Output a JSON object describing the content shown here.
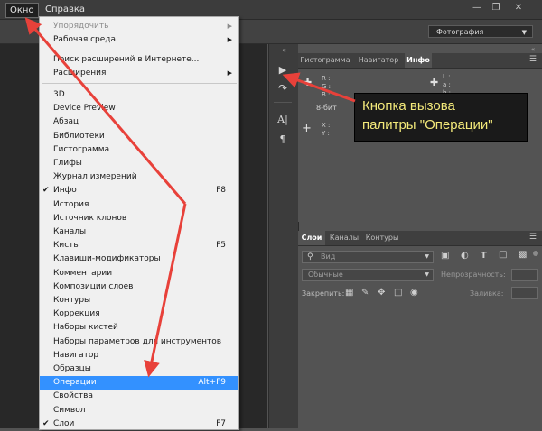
{
  "menubar": {
    "items": [
      "Окно",
      "Справка"
    ],
    "window_controls": [
      "minimize-icon",
      "restore-icon",
      "close-icon"
    ]
  },
  "options": {
    "workspace": "Фотография"
  },
  "menu": {
    "group1": [
      "Упорядочить",
      "Рабочая среда"
    ],
    "group2": [
      "Поиск расширений в Интернете...",
      "Расширения"
    ],
    "items": [
      {
        "label": "3D",
        "shortcut": "",
        "checked": false
      },
      {
        "label": "Device Preview",
        "shortcut": "",
        "checked": false
      },
      {
        "label": "Абзац",
        "shortcut": "",
        "checked": false
      },
      {
        "label": "Библиотеки",
        "shortcut": "",
        "checked": false
      },
      {
        "label": "Гистограмма",
        "shortcut": "",
        "checked": false
      },
      {
        "label": "Глифы",
        "shortcut": "",
        "checked": false
      },
      {
        "label": "Журнал измерений",
        "shortcut": "",
        "checked": false
      },
      {
        "label": "Инфо",
        "shortcut": "F8",
        "checked": true
      },
      {
        "label": "История",
        "shortcut": "",
        "checked": false
      },
      {
        "label": "Источник клонов",
        "shortcut": "",
        "checked": false
      },
      {
        "label": "Каналы",
        "shortcut": "",
        "checked": false
      },
      {
        "label": "Кисть",
        "shortcut": "F5",
        "checked": false
      },
      {
        "label": "Клавиши-модификаторы",
        "shortcut": "",
        "checked": false
      },
      {
        "label": "Комментарии",
        "shortcut": "",
        "checked": false
      },
      {
        "label": "Композиции слоев",
        "shortcut": "",
        "checked": false
      },
      {
        "label": "Контуры",
        "shortcut": "",
        "checked": false
      },
      {
        "label": "Коррекция",
        "shortcut": "",
        "checked": false
      },
      {
        "label": "Наборы кистей",
        "shortcut": "",
        "checked": false
      },
      {
        "label": "Наборы параметров для инструментов",
        "shortcut": "",
        "checked": false
      },
      {
        "label": "Навигатор",
        "shortcut": "",
        "checked": false
      },
      {
        "label": "Образцы",
        "shortcut": "",
        "checked": false
      },
      {
        "label": "Операции",
        "shortcut": "Alt+F9",
        "checked": false,
        "highlighted": true
      },
      {
        "label": "Свойства",
        "shortcut": "",
        "checked": false
      },
      {
        "label": "Символ",
        "shortcut": "",
        "checked": false
      },
      {
        "label": "Слои",
        "shortcut": "F7",
        "checked": true
      }
    ]
  },
  "strip": {
    "collapse": "«",
    "buttons": [
      "play-icon",
      "history-icon",
      "character-icon",
      "paragraph-icon"
    ]
  },
  "info_panel": {
    "collapse": "«",
    "tabs": [
      "Гистограмма",
      "Навигатор",
      "Инфо"
    ],
    "active_tab": "Инфо",
    "left_channels": [
      "R :",
      "G :",
      "B :"
    ],
    "right_channels": [
      "L :",
      "a :",
      "b :"
    ],
    "bit_depth": "8-бит",
    "xy": [
      "X :",
      "Y :"
    ]
  },
  "layers_panel": {
    "tabs": [
      "Слои",
      "Каналы",
      "Контуры"
    ],
    "active_tab": "Слои",
    "kind_placeholder": "Вид",
    "blend_mode": "Обычные",
    "opacity_label": "Непрозрачность:",
    "lock_label": "Закрепить:",
    "fill_label": "Заливка:"
  },
  "callout": {
    "line1": "Кнопка вызова",
    "line2": "палитры \"Операции\""
  },
  "colors": {
    "annotation_arrow": "#e8413a",
    "callout_text": "#f3e97a",
    "highlight": "#3391ff"
  }
}
